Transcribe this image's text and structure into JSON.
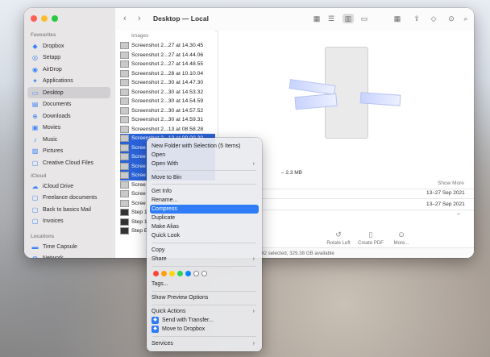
{
  "window": {
    "title": "Desktop — Local",
    "nav_back": "‹",
    "nav_forward": "›"
  },
  "sidebar": {
    "favourites_label": "Favourites",
    "favourites": [
      {
        "label": "Dropbox",
        "icon": "dropbox-icon"
      },
      {
        "label": "Setapp",
        "icon": "setapp-icon"
      },
      {
        "label": "AirDrop",
        "icon": "airdrop-icon"
      },
      {
        "label": "Applications",
        "icon": "applications-icon"
      },
      {
        "label": "Desktop",
        "icon": "desktop-icon",
        "selected": true
      },
      {
        "label": "Documents",
        "icon": "documents-icon"
      },
      {
        "label": "Downloads",
        "icon": "downloads-icon"
      },
      {
        "label": "Movies",
        "icon": "movies-icon"
      },
      {
        "label": "Music",
        "icon": "music-icon"
      },
      {
        "label": "Pictures",
        "icon": "pictures-icon"
      },
      {
        "label": "Creative Cloud Files",
        "icon": "creative-cloud-icon"
      }
    ],
    "icloud_label": "iCloud",
    "icloud": [
      {
        "label": "iCloud Drive",
        "icon": "icloud-icon"
      },
      {
        "label": "Freelance documents",
        "icon": "folder-icon"
      },
      {
        "label": "Back to basics Mail",
        "icon": "folder-icon"
      },
      {
        "label": "Invoices",
        "icon": "folder-icon"
      }
    ],
    "locations_label": "Locations",
    "locations": [
      {
        "label": "Time Capsule",
        "icon": "time-capsule-icon"
      },
      {
        "label": "Network",
        "icon": "network-icon"
      }
    ]
  },
  "file_list": {
    "header": "Images",
    "rows": [
      {
        "name": "Screenshot 2...27 at 14.30.45",
        "selected": false
      },
      {
        "name": "Screenshot 2...27 at 14.44.06",
        "selected": false
      },
      {
        "name": "Screenshot 2...27 at 14.48.55",
        "selected": false
      },
      {
        "name": "Screenshot 2...28 at 10.10.04",
        "selected": false
      },
      {
        "name": "Screenshot 2...30 at 14.47.30",
        "selected": false
      },
      {
        "name": "Screenshot 2...30 at 14.53.32",
        "selected": false
      },
      {
        "name": "Screenshot 2...30 at 14.54.59",
        "selected": false
      },
      {
        "name": "Screenshot 2...30 at 14.57.52",
        "selected": false
      },
      {
        "name": "Screenshot 2...30 at 14.59.31",
        "selected": false
      },
      {
        "name": "Screenshot 2...13 at 08.58.28",
        "selected": false
      },
      {
        "name": "Screenshot 2...13 at 09.00.30",
        "selected": true
      },
      {
        "name": "Scree",
        "selected": true
      },
      {
        "name": "Scree",
        "selected": true
      },
      {
        "name": "Scree",
        "selected": true
      },
      {
        "name": "Scree",
        "selected": true
      },
      {
        "name": "Scree",
        "selected": false
      },
      {
        "name": "Scree",
        "selected": false
      },
      {
        "name": "Scree",
        "selected": false
      },
      {
        "name": "Step 1",
        "selected": false,
        "dark": true
      },
      {
        "name": "Step 1",
        "selected": false,
        "dark": true
      },
      {
        "name": "Step E",
        "selected": false,
        "dark": true
      }
    ]
  },
  "preview": {
    "size_text": "– 2.3 MB",
    "show_more": "Show More",
    "date_1": "13–27 Sep 2021",
    "date_2": "13–27 Sep 2021",
    "dash": "--",
    "actions": [
      {
        "label": "Rotate Left",
        "icon": "rotate-left-icon"
      },
      {
        "label": "Create PDF",
        "icon": "create-pdf-icon"
      },
      {
        "label": "More...",
        "icon": "more-icon"
      }
    ],
    "status": "42 selected, 329.38 GB available"
  },
  "context_menu": {
    "items_group1": [
      "New Folder with Selection (5 Items)",
      "Open",
      "Open With"
    ],
    "move_to_bin": "Move to Bin",
    "items_group3": [
      "Get Info",
      "Rename...",
      "Compress",
      "Duplicate",
      "Make Alias",
      "Quick Look"
    ],
    "items_group4": [
      "Copy",
      "Share"
    ],
    "tag_colors": [
      "#ff453a",
      "#ff9f0a",
      "#ffd60a",
      "#30d158",
      "#0a84ff",
      "#ffffff",
      "#ffffff"
    ],
    "tags_label": "Tags...",
    "show_preview_options": "Show Preview Options",
    "quick_actions": "Quick Actions",
    "send_with_transfer": "Send with Transfer...",
    "move_to_dropbox": "Move to Dropbox",
    "services": "Services",
    "highlighted": "Compress"
  }
}
